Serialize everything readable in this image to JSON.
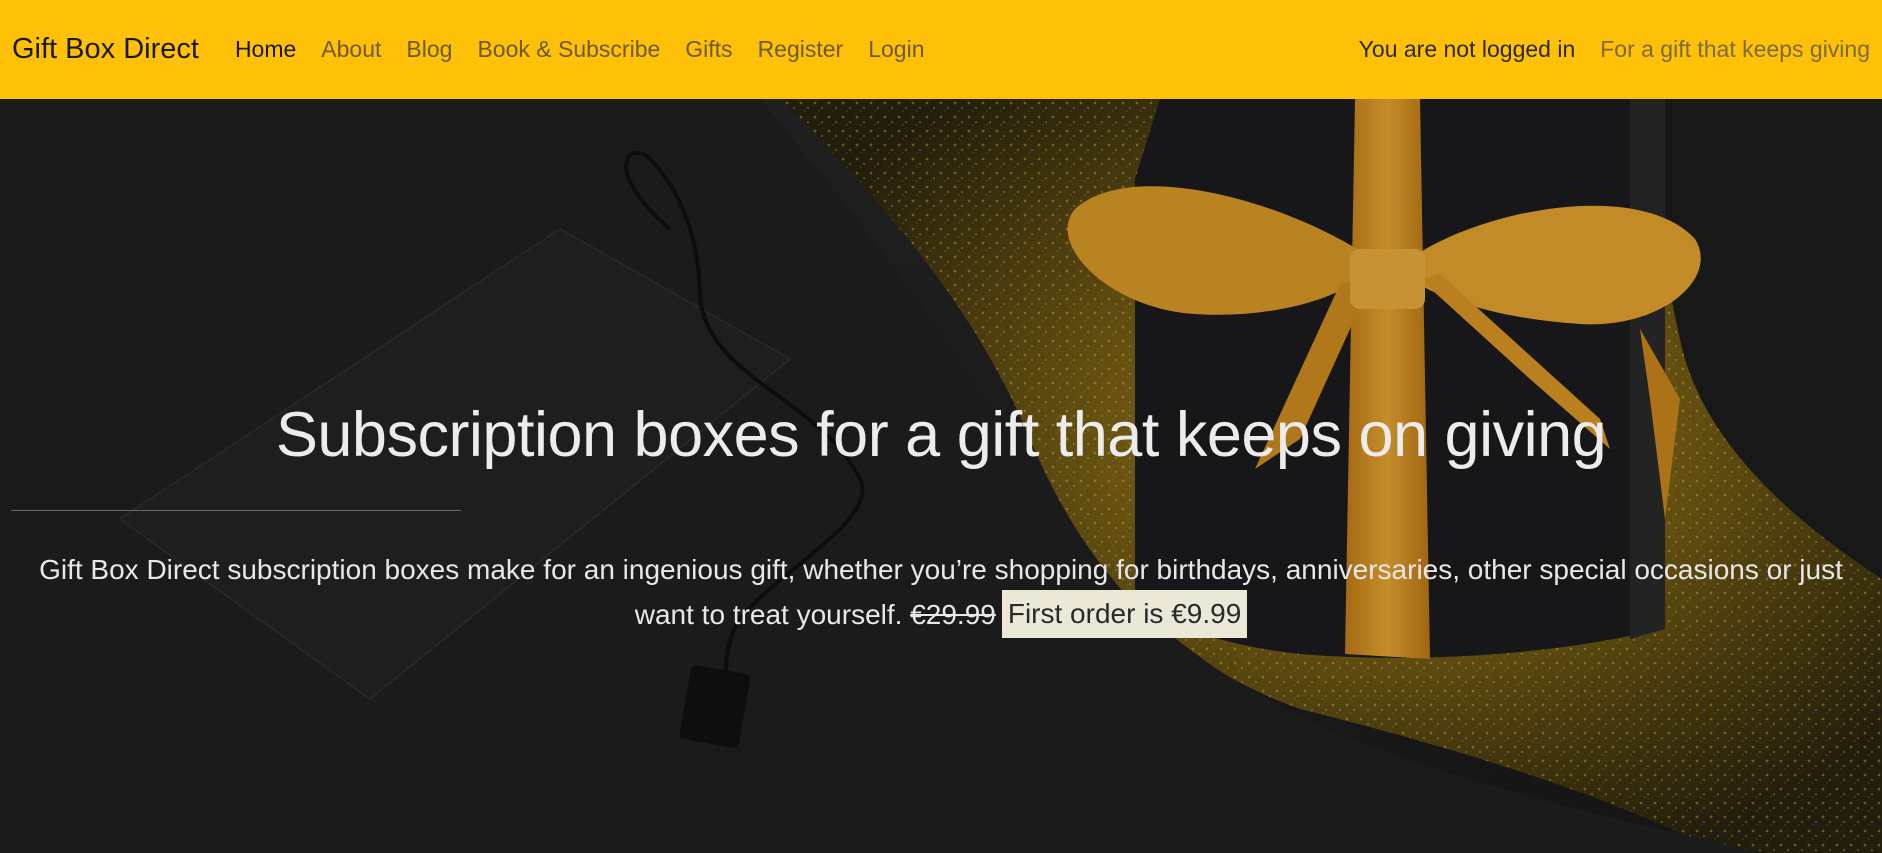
{
  "navbar": {
    "brand": "Gift Box Direct",
    "links": [
      {
        "label": "Home"
      },
      {
        "label": "About"
      },
      {
        "label": "Blog"
      },
      {
        "label": "Book & Subscribe"
      },
      {
        "label": "Gifts"
      },
      {
        "label": "Register"
      },
      {
        "label": "Login"
      }
    ],
    "status": "You are not logged in",
    "tagline": "For a gift that keeps giving"
  },
  "hero": {
    "title": "Subscription boxes for a gift that keeps on giving",
    "lead": "Gift Box Direct subscription boxes make for an ingenious gift, whether you’re shopping for birthdays, anniversaries, other special occasions or just want to treat yourself.",
    "old_price": "€29.99",
    "offer": "First order is €9.99"
  },
  "colors": {
    "navbar_bg": "#ffc107",
    "offer_bg": "#ece8d8",
    "ribbon": "#e9a227"
  }
}
